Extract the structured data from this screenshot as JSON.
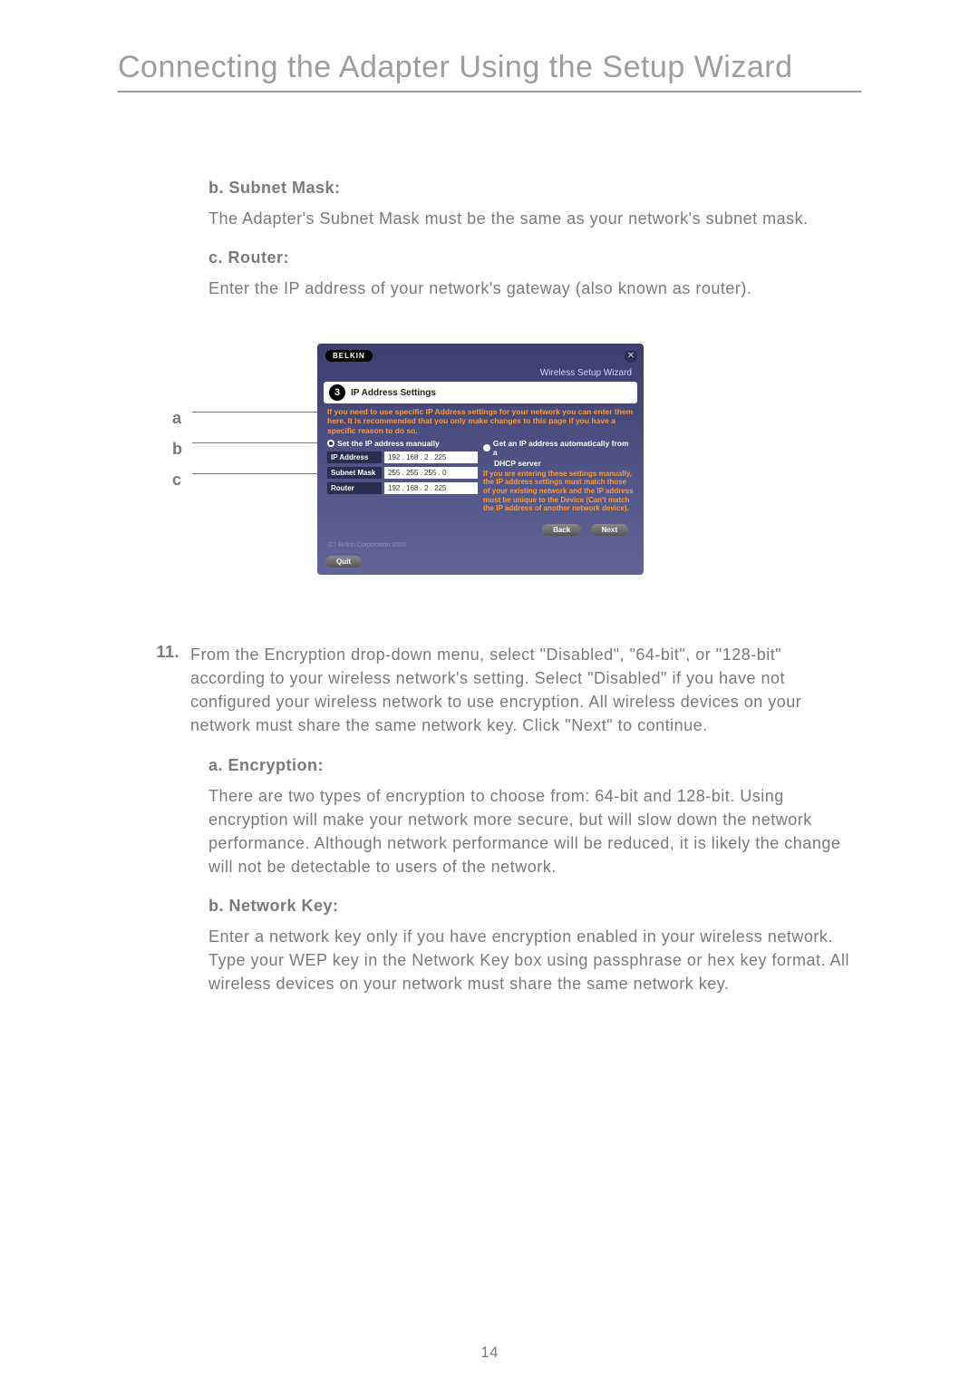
{
  "page": {
    "title": "Connecting the Adapter Using the Setup Wizard",
    "page_number": "14"
  },
  "sections": {
    "subnet": {
      "heading": "b. Subnet Mask:",
      "body": "The Adapter's Subnet Mask must be the same as your network's subnet mask."
    },
    "router": {
      "heading": "c. Router:",
      "body": "Enter the IP address of your network's gateway (also known as router)."
    },
    "step11": {
      "num": "11.",
      "body": "From the Encryption drop-down menu, select \"Disabled\", \"64-bit\", or \"128-bit\" according to your wireless network's setting. Select \"Disabled\" if you have not configured your wireless network to use encryption. All wireless devices on your network must share the same network key. Click \"Next\" to continue."
    },
    "encryption": {
      "heading": "a. Encryption:",
      "body": "There are two types of encryption to choose from: 64-bit and 128-bit. Using encryption will make your network more secure, but will slow down the network performance. Although network performance will be reduced, it is likely the change will not be detectable to users of the network."
    },
    "networkkey": {
      "heading": "b. Network Key:",
      "body": "Enter a network key only if you have encryption enabled in your wireless network. Type your WEP key in the Network Key box using passphrase or hex key format. All wireless devices on your network must share the same network key."
    }
  },
  "callouts": {
    "a": "a",
    "b": "b",
    "c": "c"
  },
  "wizard": {
    "brand": "BELKIN",
    "title": "Wireless Setup Wizard",
    "step": "3",
    "header": "IP Address Settings",
    "warn": "If you need to use specific IP Address settings for your network you can enter them here. It is recommended that you only make changes to this page if you have a specific reason to do so.",
    "radio_manual": "Set the IP address manually",
    "radio_dhcp": "Get an IP address automatically from a",
    "dhcp_sub": "DHCP server",
    "fields": {
      "ip_label": "IP Address",
      "ip_value": "192 . 168 .  2   . 225",
      "subnet_label": "Subnet Mask",
      "subnet_value": "255 . 255 . 255 .  0",
      "router_label": "Router",
      "router_value": "192 . 168 .  2   . 225"
    },
    "right_text": "If you are entering these settings manually, the IP address settings must match those of your existing network and the IP address must be unique to the Device (Can't match the IP address of another network device).",
    "back": "Back",
    "next": "Next",
    "copyright": "(C) Belkin Corporation 2003",
    "quit": "Quit"
  }
}
